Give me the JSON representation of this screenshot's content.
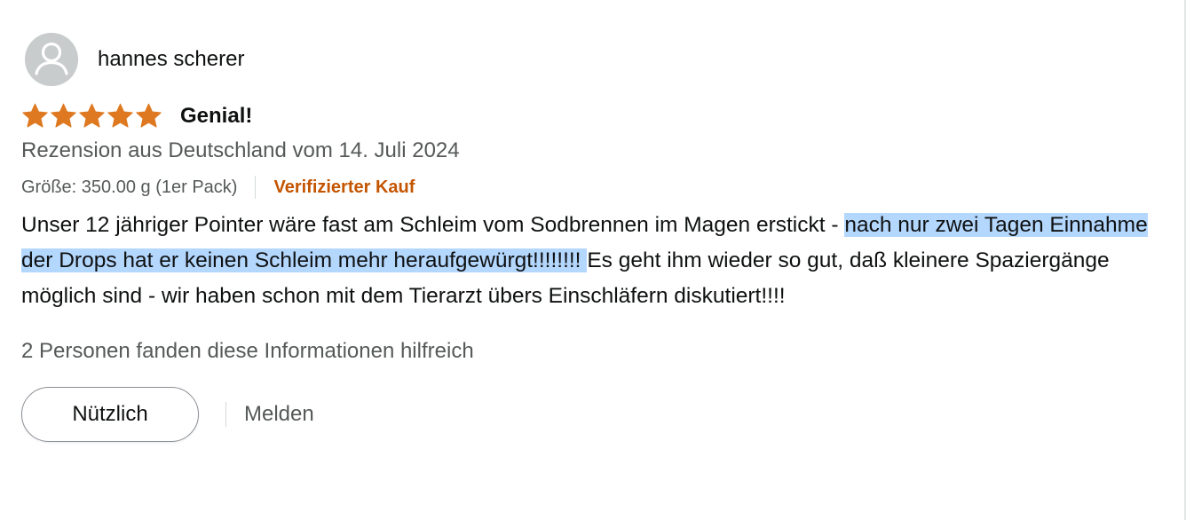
{
  "review": {
    "profile_name": "hannes scherer",
    "avatar_icon": "user-silhouette-icon",
    "rating": 5,
    "rating_max": 5,
    "star_color": "#de7921",
    "title": "Genial!",
    "date": "Rezension aus Deutschland vom 14. Juli 2024",
    "variant": "Größe: 350.00 g (1er Pack)",
    "verified": "Verifizierter Kauf",
    "verified_color": "#c45500",
    "body": {
      "before": "Unser 12 jähriger Pointer wäre fast am Schleim vom Sodbrennen im Magen erstickt - ",
      "highlighted": "nach nur zwei Tagen Einnahme der Drops hat er keinen Schleim mehr heraufgewürgt!!!!!!!! ",
      "after": "Es geht ihm wieder so gut, daß kleinere Spaziergänge möglich sind - wir haben schon mit dem Tierarzt übers Einschläfern diskutiert!!!!"
    },
    "highlight_color": "#b4d7fe",
    "helpful_text": "2 Personen fanden diese Informationen hilfreich",
    "helpful_button_label": "Nützlich",
    "report_label": "Melden"
  }
}
